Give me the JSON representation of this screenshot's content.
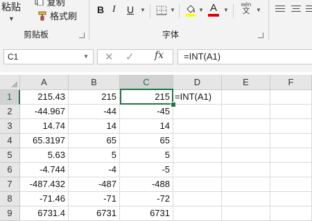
{
  "ribbon": {
    "clipboard": {
      "paste_label": "粘贴",
      "copy_label": "复制",
      "format_painter_label": "格式刷",
      "group_label": "剪贴板"
    },
    "font": {
      "bold": "B",
      "italic": "I",
      "underline": "U",
      "font_color_glyph": "A",
      "phonetic_top": "wén",
      "phonetic_bottom": "文",
      "group_label": "字体"
    }
  },
  "formula_bar": {
    "name_box": "C1",
    "cancel": "✕",
    "enter": "✓",
    "fx": "fx",
    "formula": "=INT(A1)"
  },
  "columns": [
    "A",
    "B",
    "C",
    "D",
    "E",
    "F"
  ],
  "rows": [
    {
      "num": "1",
      "a": "215.43",
      "b": "215",
      "c": "215",
      "d": "=INT(A1)"
    },
    {
      "num": "2",
      "a": "-44.967",
      "b": "-44",
      "c": "-45",
      "d": ""
    },
    {
      "num": "3",
      "a": "14.74",
      "b": "14",
      "c": "14",
      "d": ""
    },
    {
      "num": "4",
      "a": "65.3197",
      "b": "65",
      "c": "65",
      "d": ""
    },
    {
      "num": "5",
      "a": "5.63",
      "b": "5",
      "c": "5",
      "d": ""
    },
    {
      "num": "6",
      "a": "-4.744",
      "b": "-4",
      "c": "-5",
      "d": ""
    },
    {
      "num": "7",
      "a": "-487.432",
      "b": "-487",
      "c": "-488",
      "d": ""
    },
    {
      "num": "8",
      "a": "-71.46",
      "b": "-71",
      "c": "-72",
      "d": ""
    },
    {
      "num": "9",
      "a": "6731.4",
      "b": "6731",
      "c": "6731",
      "d": ""
    }
  ],
  "colors": {
    "accent": "#217346",
    "highlight_yellow": "#ffff00",
    "font_red": "#e00000"
  }
}
